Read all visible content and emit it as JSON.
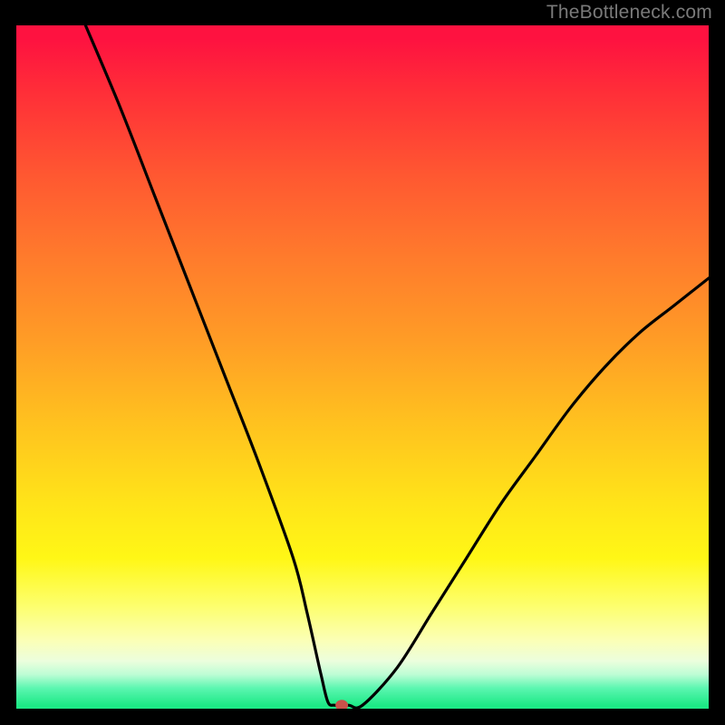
{
  "watermark": "TheBottleneck.com",
  "chart_data": {
    "type": "line",
    "title": "",
    "xlabel": "",
    "ylabel": "",
    "xlim": [
      0,
      100
    ],
    "ylim": [
      0,
      100
    ],
    "grid": false,
    "legend": false,
    "series": [
      {
        "name": "bottleneck-curve",
        "x": [
          10,
          15,
          20,
          25,
          30,
          35,
          40,
          42,
          44,
          45,
          46,
          48,
          50,
          55,
          60,
          65,
          70,
          75,
          80,
          85,
          90,
          95,
          100
        ],
        "values": [
          100,
          88,
          75,
          62,
          49,
          36,
          22,
          14,
          5,
          1,
          0.5,
          0.5,
          0.5,
          6,
          14,
          22,
          30,
          37,
          44,
          50,
          55,
          59,
          63
        ]
      }
    ],
    "marker": {
      "x": 47,
      "y": 0.5
    },
    "background_gradient": {
      "direction": "vertical",
      "stops": [
        {
          "pos": 0.0,
          "color": "#fe1240"
        },
        {
          "pos": 0.1,
          "color": "#ff2f38"
        },
        {
          "pos": 0.22,
          "color": "#ff5831"
        },
        {
          "pos": 0.34,
          "color": "#ff7b2c"
        },
        {
          "pos": 0.46,
          "color": "#ff9c26"
        },
        {
          "pos": 0.58,
          "color": "#ffc11f"
        },
        {
          "pos": 0.7,
          "color": "#ffe419"
        },
        {
          "pos": 0.78,
          "color": "#fff716"
        },
        {
          "pos": 0.85,
          "color": "#fdff6e"
        },
        {
          "pos": 0.9,
          "color": "#fbffb6"
        },
        {
          "pos": 0.93,
          "color": "#ecfedd"
        },
        {
          "pos": 0.95,
          "color": "#bdfdd5"
        },
        {
          "pos": 0.97,
          "color": "#5bf6b0"
        },
        {
          "pos": 1.0,
          "color": "#1de986"
        }
      ]
    }
  }
}
